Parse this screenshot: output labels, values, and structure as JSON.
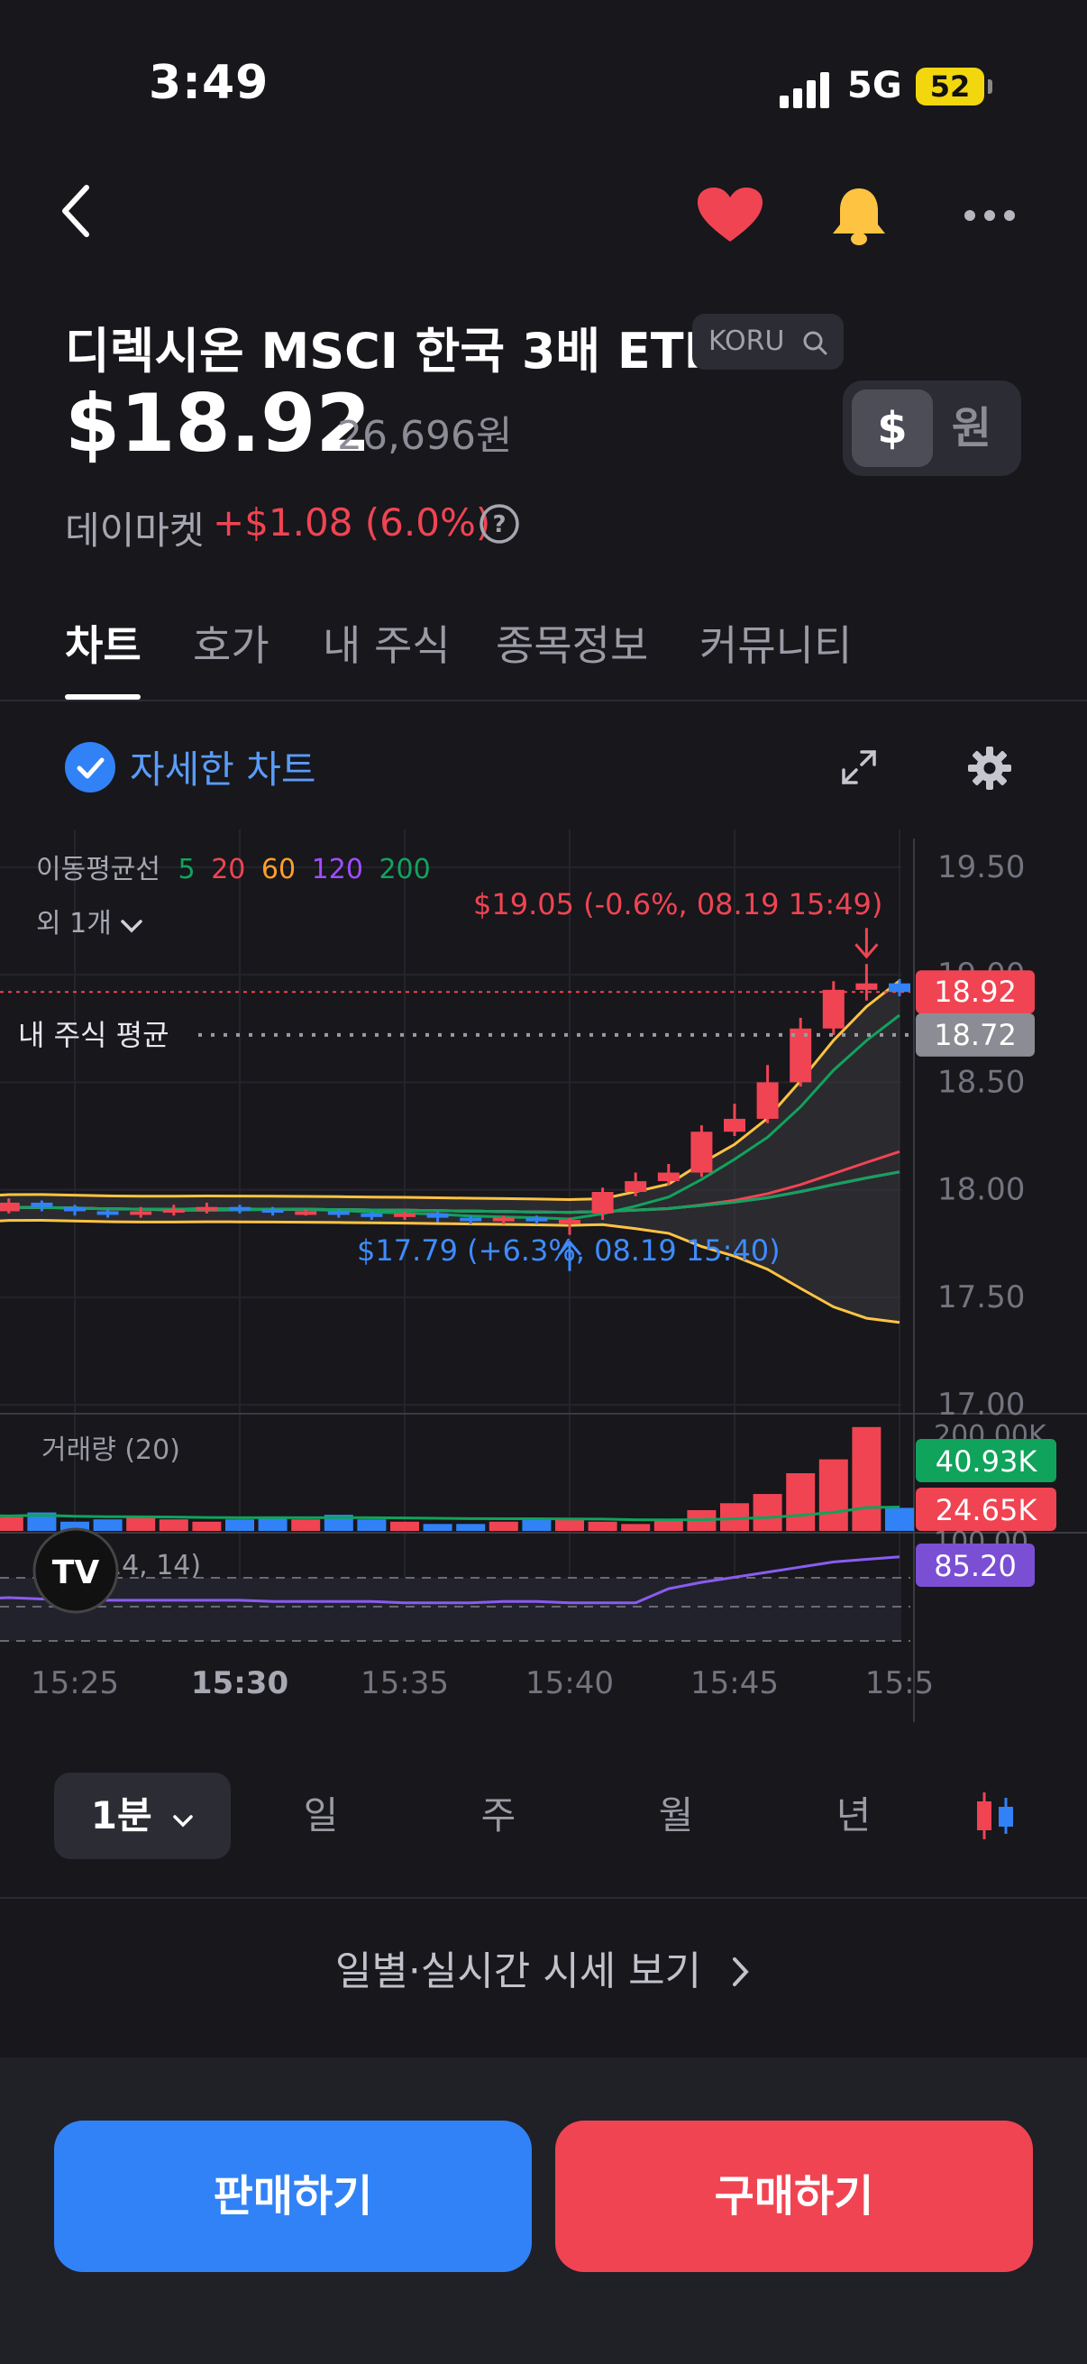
{
  "status": {
    "time": "3:49",
    "network": "5G",
    "battery": "52"
  },
  "header": {
    "title": "디렉시온 MSCI 한국 3배 ETF",
    "ticker": "KORU"
  },
  "quote": {
    "price": "$18.92",
    "price_krw": "26,696원",
    "currency_usd": "$",
    "currency_krw": "원",
    "day_market_label": "데이마켓",
    "day_change": "+$1.08 (6.0%)"
  },
  "tabs": [
    {
      "label": "차트"
    },
    {
      "label": "호가"
    },
    {
      "label": "내 주식"
    },
    {
      "label": "종목정보"
    },
    {
      "label": "커뮤니티"
    }
  ],
  "detail": {
    "label": "자세한 차트"
  },
  "chart": {
    "ma_label": "이동평균선",
    "ma_periods": [
      {
        "label": "5",
        "color": "#10a35c"
      },
      {
        "label": "20",
        "color": "#f04452"
      },
      {
        "label": "60",
        "color": "#ff9e2c"
      },
      {
        "label": "120",
        "color": "#a24cff"
      },
      {
        "label": "200",
        "color": "#12a35d"
      }
    ],
    "more_label": "외 1개",
    "avg_label": "내 주식 평균",
    "high_annotation": "$19.05 (-0.6%, 08.19 15:49)",
    "low_annotation": "$17.79 (+6.3%, 08.19 15:40)",
    "volume_label": "거래량 (20)",
    "rsi_label": "RSI (14, 14)",
    "price_axis": [
      "19.50",
      "19.00",
      "18.50",
      "18.00",
      "17.50",
      "17.00"
    ],
    "volume_axis_top": "200.00K",
    "rsi_axis_top": "100.00",
    "badges": {
      "current": "18.92",
      "avg": "18.72",
      "vol1": "40.93K",
      "vol2": "24.65K",
      "rsi": "85.20"
    },
    "time_axis": [
      "15:25",
      "15:30",
      "15:35",
      "15:40",
      "15:45",
      "15:5"
    ]
  },
  "chart_data": {
    "type": "candlestick",
    "interval": "1분",
    "x": [
      "15:20",
      "15:21",
      "15:22",
      "15:23",
      "15:24",
      "15:25",
      "15:26",
      "15:27",
      "15:28",
      "15:29",
      "15:30",
      "15:31",
      "15:32",
      "15:33",
      "15:34",
      "15:35",
      "15:36",
      "15:37",
      "15:38",
      "15:39",
      "15:40",
      "15:41",
      "15:42",
      "15:43",
      "15:44",
      "15:45",
      "15:46",
      "15:47",
      "15:48",
      "15:49",
      "15:50"
    ],
    "open": [
      17.9,
      17.91,
      17.92,
      17.9,
      17.94,
      17.92,
      17.9,
      17.89,
      17.9,
      17.91,
      17.92,
      17.91,
      17.9,
      17.9,
      17.89,
      17.88,
      17.89,
      17.87,
      17.86,
      17.87,
      17.86,
      17.89,
      17.99,
      18.04,
      18.08,
      18.27,
      18.33,
      18.5,
      18.75,
      18.93,
      18.96
    ],
    "close": [
      17.91,
      17.92,
      17.9,
      17.94,
      17.92,
      17.9,
      17.89,
      17.9,
      17.91,
      17.92,
      17.91,
      17.9,
      17.9,
      17.89,
      17.88,
      17.89,
      17.87,
      17.86,
      17.87,
      17.86,
      17.86,
      17.99,
      18.04,
      18.08,
      18.27,
      18.33,
      18.5,
      18.75,
      18.93,
      18.96,
      18.92
    ],
    "high": [
      17.93,
      17.94,
      17.93,
      17.96,
      17.95,
      17.93,
      17.91,
      17.92,
      17.93,
      17.94,
      17.93,
      17.92,
      17.91,
      17.91,
      17.9,
      17.9,
      17.9,
      17.88,
      17.88,
      17.88,
      17.87,
      18.01,
      18.08,
      18.12,
      18.3,
      18.4,
      18.58,
      18.8,
      18.97,
      19.05,
      18.98
    ],
    "low": [
      17.88,
      17.89,
      17.88,
      17.89,
      17.9,
      17.88,
      17.87,
      17.87,
      17.88,
      17.89,
      17.89,
      17.88,
      17.88,
      17.87,
      17.86,
      17.86,
      17.85,
      17.84,
      17.84,
      17.84,
      17.79,
      17.86,
      17.97,
      18.02,
      18.06,
      18.25,
      18.31,
      18.48,
      18.72,
      18.88,
      18.9
    ],
    "volume": [
      6,
      5,
      9,
      6,
      8,
      4,
      5,
      6,
      5,
      4,
      5,
      6,
      5,
      7,
      5,
      4,
      3,
      3,
      4,
      5,
      5,
      4,
      3,
      5,
      9,
      12,
      16,
      25,
      31,
      45,
      10
    ],
    "ylim": [
      16.95,
      19.55
    ],
    "volume_ylim": [
      0,
      200
    ],
    "rsi": [
      48,
      47,
      47,
      48,
      47,
      47,
      46,
      46,
      46,
      46,
      46,
      45,
      45,
      45,
      45,
      44,
      44,
      44,
      45,
      45,
      44,
      44,
      44,
      55,
      60,
      64,
      68,
      72,
      76,
      78,
      80
    ],
    "rsi_ylim": [
      0,
      100
    ],
    "colors": {
      "up": "#f04452",
      "down": "#3182f6"
    }
  },
  "periods": [
    {
      "label": "1분"
    },
    {
      "label": "일"
    },
    {
      "label": "주"
    },
    {
      "label": "월"
    },
    {
      "label": "년"
    }
  ],
  "daily_link": {
    "label": "일별·실시간 시세 보기"
  },
  "actions": {
    "sell": "판매하기",
    "buy": "구매하기"
  }
}
